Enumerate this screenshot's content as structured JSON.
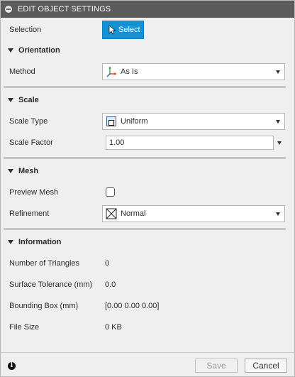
{
  "title": "EDIT OBJECT SETTINGS",
  "selection": {
    "label": "Selection",
    "button_label": "Select"
  },
  "orientation": {
    "header": "Orientation",
    "method_label": "Method",
    "method_value": "As Is",
    "method_icon": "axes-icon"
  },
  "scale": {
    "header": "Scale",
    "type_label": "Scale Type",
    "type_value": "Uniform",
    "type_icon": "uniform-scale-icon",
    "factor_label": "Scale Factor",
    "factor_value": "1.00"
  },
  "mesh": {
    "header": "Mesh",
    "preview_label": "Preview Mesh",
    "preview_checked": false,
    "refinement_label": "Refinement",
    "refinement_value": "Normal",
    "refinement_icon": "mesh-refinement-icon"
  },
  "information": {
    "header": "Information",
    "triangles_label": "Number of Triangles",
    "triangles_value": "0",
    "tolerance_label": "Surface Tolerance (mm)",
    "tolerance_value": "0.0",
    "bbox_label": "Bounding Box (mm)",
    "bbox_value": "[0.00 0.00 0.00]",
    "filesize_label": "File Size",
    "filesize_value": "0 KB"
  },
  "footer": {
    "save_label": "Save",
    "cancel_label": "Cancel",
    "save_enabled": false
  },
  "colors": {
    "accent": "#1592d6",
    "titlebar": "#5c5c5c",
    "panel_bg": "#efefef"
  }
}
